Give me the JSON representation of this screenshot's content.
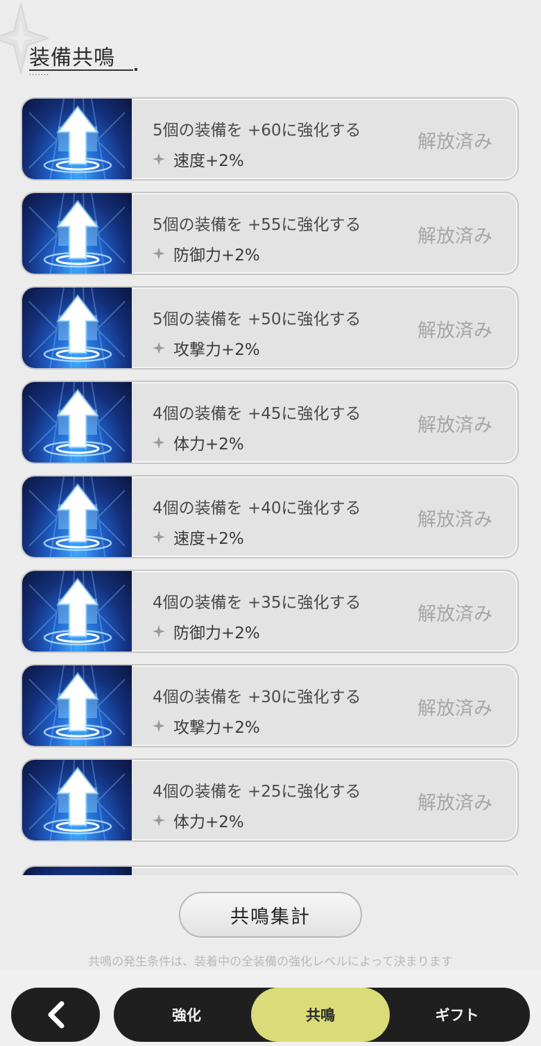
{
  "header": {
    "title": "装備共鳴"
  },
  "resonance_items": [
    {
      "condition": "5個の装備を +60に強化する",
      "bonus": "速度+2%",
      "status": "解放済み"
    },
    {
      "condition": "5個の装備を +55に強化する",
      "bonus": "防御力+2%",
      "status": "解放済み"
    },
    {
      "condition": "5個の装備を +50に強化する",
      "bonus": "攻撃力+2%",
      "status": "解放済み"
    },
    {
      "condition": "4個の装備を +45に強化する",
      "bonus": "体力+2%",
      "status": "解放済み"
    },
    {
      "condition": "4個の装備を +40に強化する",
      "bonus": "速度+2%",
      "status": "解放済み"
    },
    {
      "condition": "4個の装備を +35に強化する",
      "bonus": "防御力+2%",
      "status": "解放済み"
    },
    {
      "condition": "4個の装備を +30に強化する",
      "bonus": "攻撃力+2%",
      "status": "解放済み"
    },
    {
      "condition": "4個の装備を +25に強化する",
      "bonus": "体力+2%",
      "status": "解放済み"
    }
  ],
  "summary_button": {
    "label": "共鳴集計"
  },
  "footnote": "共鳴の発生条件は、装着中の全装備の強化レベルによって決まります",
  "nav": {
    "back_icon": "chevron-left-icon",
    "tabs": [
      {
        "label": "強化",
        "active": false
      },
      {
        "label": "共鳴",
        "active": true
      },
      {
        "label": "ギフト",
        "active": false
      }
    ]
  },
  "colors": {
    "active_tab": "#d9dc78",
    "nav_bg": "#1f1f1f",
    "status_text": "#a6a6a6"
  }
}
